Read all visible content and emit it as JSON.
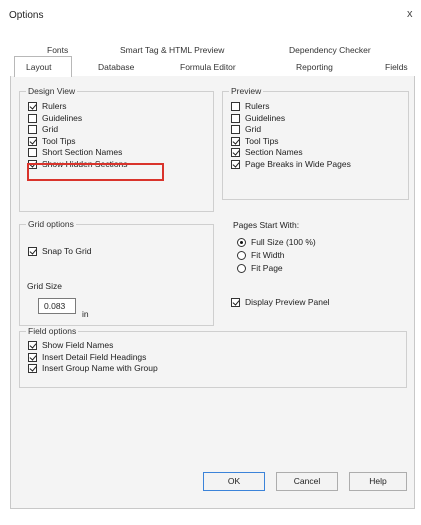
{
  "window": {
    "title": "Options",
    "close_glyph": "x"
  },
  "tabs": {
    "row1": [
      "Fonts",
      "Smart Tag & HTML Preview",
      "Dependency Checker"
    ],
    "row2": [
      "Layout",
      "Database",
      "Formula Editor",
      "Reporting",
      "Fields"
    ],
    "active": "Layout"
  },
  "design_view": {
    "legend": "Design View",
    "items": [
      {
        "label": "Rulers",
        "checked": true
      },
      {
        "label": "Guidelines",
        "checked": false
      },
      {
        "label": "Grid",
        "checked": false
      },
      {
        "label": "Tool Tips",
        "checked": true
      },
      {
        "label": "Short Section Names",
        "checked": false
      },
      {
        "label": "Show Hidden Sections",
        "checked": true
      }
    ]
  },
  "preview": {
    "legend": "Preview",
    "items": [
      {
        "label": "Rulers",
        "checked": false
      },
      {
        "label": "Guidelines",
        "checked": false
      },
      {
        "label": "Grid",
        "checked": false
      },
      {
        "label": "Tool Tips",
        "checked": true
      },
      {
        "label": "Section Names",
        "checked": true
      },
      {
        "label": "Page Breaks in Wide Pages",
        "checked": true
      }
    ]
  },
  "grid_options": {
    "legend": "Grid options",
    "snap_label": "Snap To Grid",
    "snap_checked": true,
    "size_label": "Grid Size",
    "size_value": "0.083",
    "size_unit": "in"
  },
  "pages_start": {
    "label": "Pages Start With:",
    "options": [
      "Full Size (100 %)",
      "Fit Width",
      "Fit Page"
    ],
    "selected": 0,
    "display_panel_label": "Display Preview Panel",
    "display_panel_checked": true
  },
  "field_options": {
    "legend": "Field options",
    "items": [
      {
        "label": "Show Field Names",
        "checked": true
      },
      {
        "label": "Insert Detail Field Headings",
        "checked": true
      },
      {
        "label": "Insert Group Name with Group",
        "checked": true
      }
    ]
  },
  "buttons": {
    "ok": "OK",
    "cancel": "Cancel",
    "help": "Help"
  },
  "colors": {
    "highlight": "#d9332b",
    "ok_border": "#3b83d9"
  }
}
